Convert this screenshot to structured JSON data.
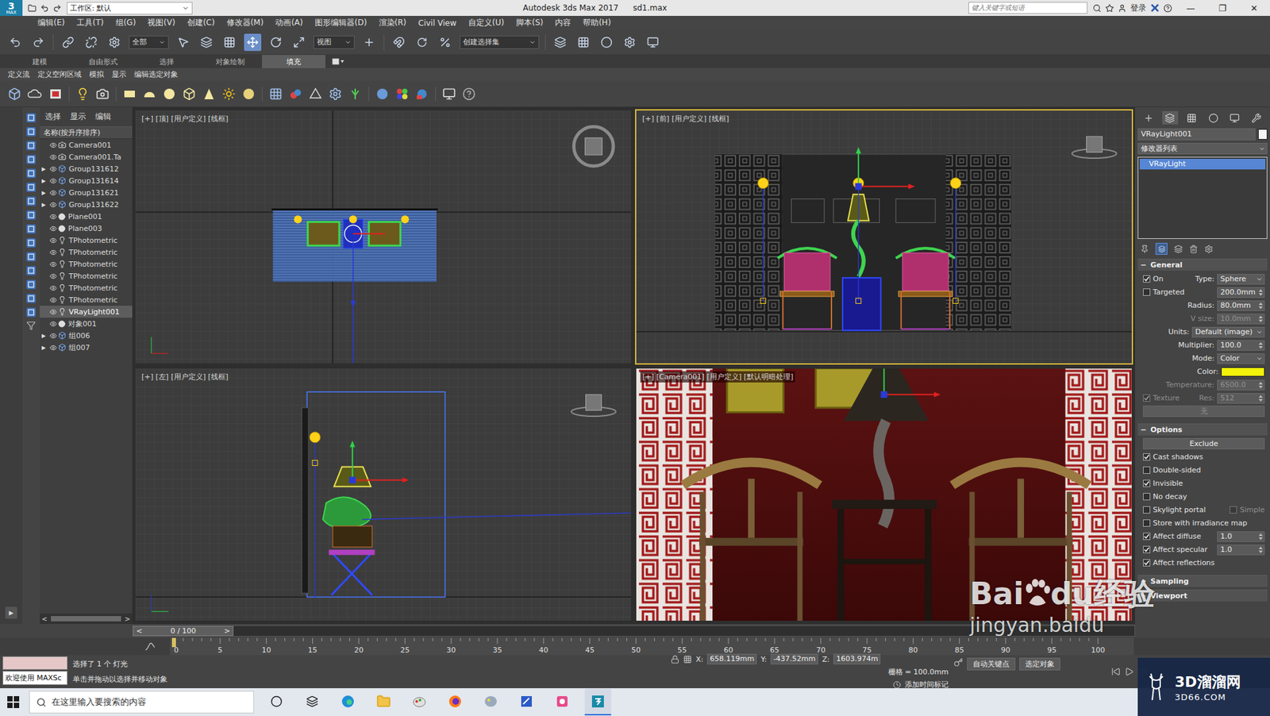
{
  "title_bar": {
    "logo": "3",
    "logo_sub": "MAX",
    "workspace": "工作区: 默认",
    "title": "Autodesk 3ds Max 2017",
    "file": "sd1.max",
    "search_placeholder": "键入关键字或短语",
    "login": "登录",
    "window_controls": [
      "—",
      "❐",
      "✕"
    ]
  },
  "menu": [
    "编辑(E)",
    "工具(T)",
    "组(G)",
    "视图(V)",
    "创建(C)",
    "修改器(M)",
    "动画(A)",
    "图形编辑器(D)",
    "渲染(R)",
    "Civil View",
    "自定义(U)",
    "脚本(S)",
    "内容",
    "帮助(H)"
  ],
  "main_toolbar": {
    "filter": "全部",
    "coord": "视图",
    "selection_set": "创建选择集"
  },
  "ribbon": {
    "tabs": [
      {
        "label": "建模",
        "selected": false
      },
      {
        "label": "自由形式",
        "selected": false
      },
      {
        "label": "选择",
        "selected": false
      },
      {
        "label": "对象绘制",
        "selected": false
      },
      {
        "label": "填充",
        "selected": true
      }
    ],
    "panels": [
      "定义流",
      "定义空闲区域",
      "模拟",
      "显示",
      "编辑选定对象"
    ]
  },
  "explorer": {
    "tabs": [
      "选择",
      "显示",
      "编辑"
    ],
    "header": "名称(按升序排序)",
    "expand_glyph": "▶",
    "scroll_prev": "<",
    "scroll_next": ">",
    "items": [
      {
        "name": "Camera001",
        "kind": "camera",
        "expandable": false,
        "selected": false
      },
      {
        "name": "Camera001.Ta",
        "kind": "camera",
        "expandable": false,
        "selected": false
      },
      {
        "name": "Group131612",
        "kind": "group",
        "expandable": true,
        "selected": false
      },
      {
        "name": "Group131614",
        "kind": "group",
        "expandable": true,
        "selected": false
      },
      {
        "name": "Group131621",
        "kind": "group",
        "expandable": true,
        "selected": false
      },
      {
        "name": "Group131622",
        "kind": "group",
        "expandable": true,
        "selected": false
      },
      {
        "name": "Plane001",
        "kind": "geometry",
        "expandable": false,
        "selected": false
      },
      {
        "name": "Plane003",
        "kind": "geometry",
        "expandable": false,
        "selected": false
      },
      {
        "name": "TPhotometric",
        "kind": "light",
        "expandable": false,
        "selected": false
      },
      {
        "name": "TPhotometric",
        "kind": "light",
        "expandable": false,
        "selected": false
      },
      {
        "name": "TPhotometric",
        "kind": "light",
        "expandable": false,
        "selected": false
      },
      {
        "name": "TPhotometric",
        "kind": "light",
        "expandable": false,
        "selected": false
      },
      {
        "name": "TPhotometric",
        "kind": "light",
        "expandable": false,
        "selected": false
      },
      {
        "name": "TPhotometric",
        "kind": "light",
        "expandable": false,
        "selected": false
      },
      {
        "name": "VRayLight001",
        "kind": "light",
        "expandable": false,
        "selected": true
      },
      {
        "name": "对象001",
        "kind": "geometry",
        "expandable": false,
        "selected": false
      },
      {
        "name": "组006",
        "kind": "group",
        "expandable": true,
        "selected": false
      },
      {
        "name": "组007",
        "kind": "group",
        "expandable": true,
        "selected": false
      }
    ]
  },
  "viewports": [
    {
      "label": "[+] [顶] [用户定义] [线框]",
      "view": "top",
      "active": false
    },
    {
      "label": "[+] [前] [用户定义] [线框]",
      "view": "front",
      "active": true
    },
    {
      "label": "[+] [左] [用户定义] [线框]",
      "view": "left",
      "active": false
    },
    {
      "label": "[+] [Camera001] [用户定义] [默认明暗处理]",
      "view": "camera",
      "active": false
    }
  ],
  "command_panel": {
    "object_name": "VRayLight001",
    "modifier_list": "修改器列表",
    "stack": [
      {
        "label": "VRayLight",
        "selected": true
      }
    ],
    "rollouts": [
      {
        "title": "General",
        "expanded": true,
        "glyph": "−",
        "rows": [
          {
            "kind": "select",
            "check": {
              "label": "On",
              "checked": true,
              "disabled": false
            },
            "label": "Type:",
            "value": "Sphere",
            "disabled": false
          },
          {
            "kind": "spinner",
            "check": {
              "label": "Targeted",
              "checked": false,
              "disabled": false
            },
            "label": "",
            "value": "200.0mm",
            "disabled": false
          },
          {
            "kind": "spinner",
            "label": "Radius:",
            "value": "80.0mm",
            "disabled": false
          },
          {
            "kind": "spinner",
            "label": "V size:",
            "value": "10.0mm",
            "disabled": true
          },
          {
            "kind": "select",
            "label": "Units:",
            "value": "Default (image)",
            "disabled": false
          },
          {
            "kind": "spinner",
            "label": "Multiplier:",
            "value": "100.0",
            "disabled": false
          },
          {
            "kind": "select",
            "label": "Mode:",
            "value": "Color",
            "disabled": false
          },
          {
            "kind": "color",
            "label": "Color:",
            "swatch": "#f2f20a",
            "disabled": false
          },
          {
            "kind": "spinner",
            "label": "Temperature:",
            "value": "6500.0",
            "disabled": true
          },
          {
            "kind": "spinner",
            "check": {
              "label": "Texture",
              "checked": true,
              "disabled": true
            },
            "label": "Res:",
            "value": "512",
            "disabled": true
          },
          {
            "kind": "button",
            "label": "无",
            "disabled": true
          }
        ]
      },
      {
        "title": "Options",
        "expanded": true,
        "glyph": "−",
        "rows": [
          {
            "kind": "button",
            "label": "Exclude",
            "disabled": false
          },
          {
            "kind": "checkbox",
            "check": {
              "label": "Cast shadows",
              "checked": true,
              "disabled": false
            }
          },
          {
            "kind": "checkbox",
            "check": {
              "label": "Double-sided",
              "checked": false,
              "disabled": false
            }
          },
          {
            "kind": "checkbox",
            "check": {
              "label": "Invisible",
              "checked": true,
              "disabled": false
            }
          },
          {
            "kind": "checkbox",
            "check": {
              "label": "No decay",
              "checked": false,
              "disabled": false
            }
          },
          {
            "kind": "pair",
            "check": {
              "label": "Skylight portal",
              "checked": false,
              "disabled": false
            },
            "check2": {
              "label": "Simple",
              "checked": false,
              "disabled": true
            }
          },
          {
            "kind": "checkbox",
            "check": {
              "label": "Store with irradiance map",
              "checked": false,
              "disabled": false
            }
          },
          {
            "kind": "spinner",
            "check": {
              "label": "Affect diffuse",
              "checked": true,
              "disabled": false
            },
            "label": "",
            "value": "1.0",
            "disabled": false
          },
          {
            "kind": "spinner",
            "check": {
              "label": "Affect specular",
              "checked": true,
              "disabled": false
            },
            "label": "",
            "value": "1.0",
            "disabled": false
          },
          {
            "kind": "checkbox",
            "check": {
              "label": "Affect reflections",
              "checked": true,
              "disabled": false
            }
          }
        ]
      },
      {
        "title": "Sampling",
        "expanded": false,
        "glyph": "+",
        "rows": []
      },
      {
        "title": "Viewport",
        "expanded": false,
        "glyph": "+",
        "rows": []
      }
    ]
  },
  "time_slider": {
    "prev": "<",
    "frame": "0 / 100",
    "next": ">",
    "level": 0
  },
  "timeline": {
    "ticks": [
      "0",
      "5",
      "10",
      "15",
      "20",
      "25",
      "30",
      "35",
      "40",
      "45",
      "50",
      "55",
      "60",
      "65",
      "70",
      "75",
      "80",
      "85",
      "90",
      "95",
      "100"
    ],
    "level": 0
  },
  "status_bar": {
    "maxscript": "欢迎使用 MAXSc",
    "selection": "选择了 1 个 灯光",
    "prompt": "单击并拖动以选择并移动对象",
    "coords": [
      {
        "label": "X:",
        "value": "658.119mm"
      },
      {
        "label": "Y:",
        "value": "-437.52mm"
      },
      {
        "label": "Z:",
        "value": "1603.974m"
      }
    ],
    "grid": "栅格 = 100.0mm",
    "add_tag": "添加时间标记",
    "auto_key": "自动关键点",
    "selected_object": "选定对象"
  },
  "taskbar": {
    "search": "在这里输入要搜索的内容"
  },
  "watermarks": {
    "baidu_a": "Bai",
    "baidu_b": "du",
    "baidu_c": "经验",
    "baidu_url": "jingyan.baidu",
    "site_name": "3D溜溜网",
    "site_url": "3D66.COM"
  }
}
